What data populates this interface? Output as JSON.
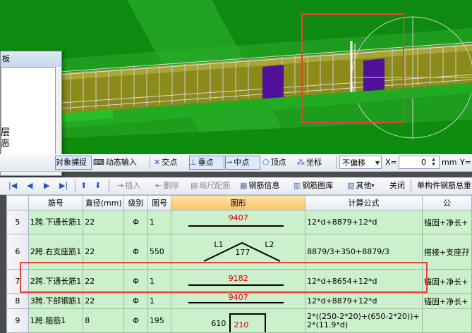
{
  "panel": {
    "title": "板",
    "side_text_1": "层",
    "side_text_2": "恶"
  },
  "snap_toolbar": {
    "object_snap": "对象捕捉",
    "dynamic_input": "动态输入",
    "intersection": "交点",
    "perpendicular": "垂点",
    "midpoint": "中点",
    "vertex": "顶点",
    "coordinate": "坐标",
    "offset_mode": "不偏移",
    "x_label": "X=",
    "x_value": "0",
    "unit": "mm",
    "y_label": "Y="
  },
  "rebar_toolbar": {
    "insert": "插入",
    "delete": "删除",
    "scale_rebar": "缩尺配筋",
    "rebar_info": "钢筋信息",
    "rebar_library": "钢筋图库",
    "other": "其他",
    "close": "关闭",
    "summary": "单构件钢筋总重"
  },
  "table": {
    "headers": [
      "筋号",
      "直径(mm)",
      "级别",
      "图号",
      "图形",
      "计算公式",
      "公"
    ],
    "rows": [
      {
        "row": "5",
        "name": "1跨.下通长筋1",
        "diameter": "22",
        "grade": "Φ",
        "shape_no": "1",
        "shape_value": "9407",
        "formula": "12*d+8879+12*d",
        "desc": "锚固+净长+"
      },
      {
        "row": "6",
        "name": "2跨.右支座筋1",
        "diameter": "22",
        "grade": "Φ",
        "shape_no": "550",
        "shape_l1": "L1",
        "shape_mid": "177",
        "shape_l2": "L2",
        "formula": "8879/3+350+8879/3",
        "desc": "搭接+支座孖"
      },
      {
        "row": "7",
        "name": "2跨.下通长筋1",
        "diameter": "22",
        "grade": "Φ",
        "shape_no": "1",
        "shape_value": "9182",
        "formula": "12*d+8654+12*d",
        "desc": "锚固+净长+"
      },
      {
        "row": "8",
        "name": "3跨.下部钢筋1",
        "diameter": "22",
        "grade": "Φ",
        "shape_no": "1",
        "shape_value": "9407",
        "formula": "12*d+8879+12*d",
        "desc": "锚固+净长+"
      },
      {
        "row": "9",
        "name": "1跨.箍筋1",
        "diameter": "8",
        "grade": "Φ",
        "shape_no": "195",
        "shape_left": "610",
        "shape_value": "210",
        "formula_1": "2*((250-2*20)+(650-2*20))+",
        "formula_2": "2*(11.9*d)",
        "desc": ""
      }
    ]
  },
  "colors": {
    "viewport_green": "#1d9c1d",
    "accent_red": "#e8413a",
    "table_green": "#cbf0cb",
    "shape_text": "#e00000"
  }
}
